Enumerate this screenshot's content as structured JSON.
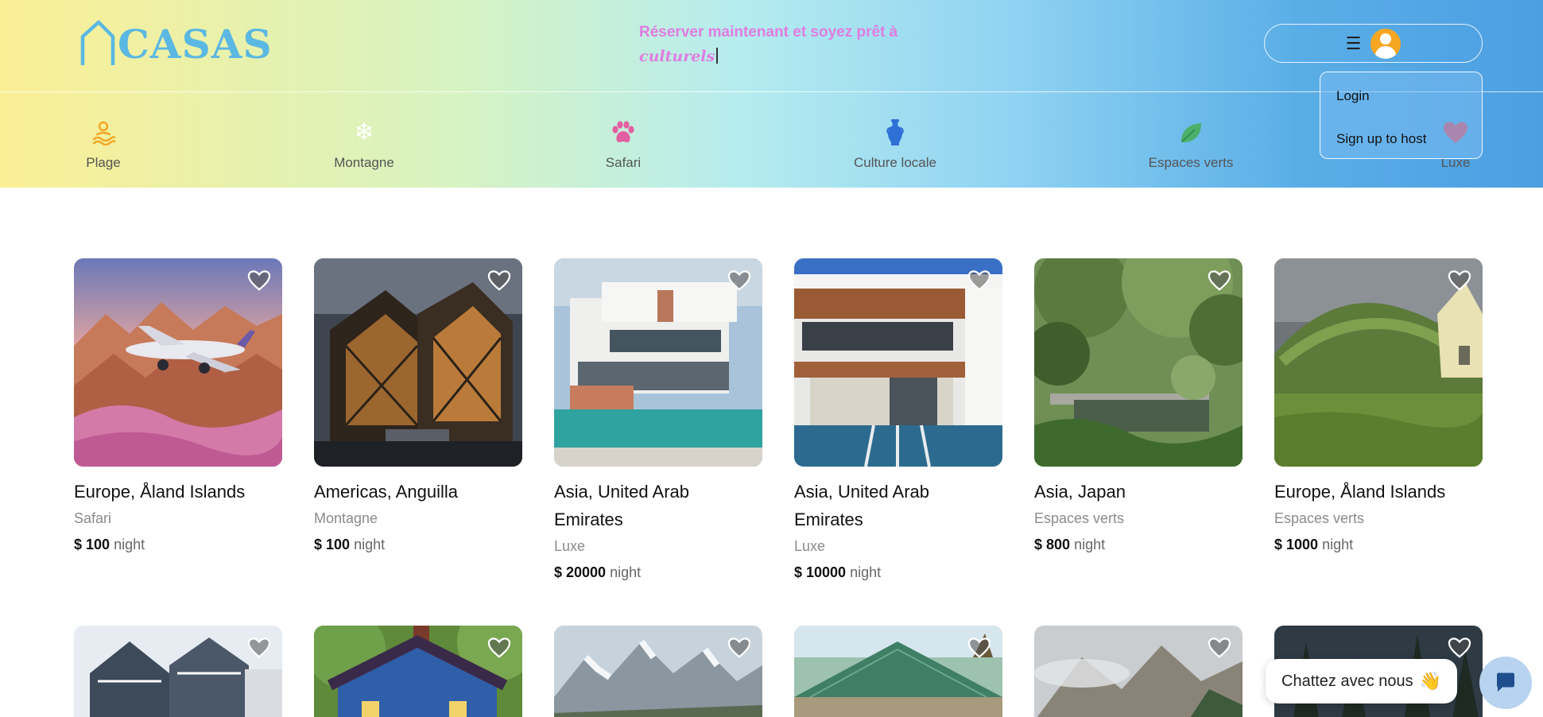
{
  "brand": {
    "name": "CASAS"
  },
  "tagline": {
    "text": "Réserver maintenant et soyez prêt à",
    "emphasis": "culturels"
  },
  "user_menu": {
    "menu_icon": "hamburger-icon",
    "avatar_icon": "user-avatar-icon"
  },
  "dropdown": {
    "login": "Login",
    "signup": "Sign up to host"
  },
  "categories": [
    {
      "label": "Plage",
      "icon": "beach-icon",
      "color": "#f5a623"
    },
    {
      "label": "Montagne",
      "icon": "snowflake-icon",
      "color": "#ffffff"
    },
    {
      "label": "Safari",
      "icon": "paw-icon",
      "color": "#e35fa1"
    },
    {
      "label": "Culture locale",
      "icon": "amphora-icon",
      "color": "#2f6fd6"
    },
    {
      "label": "Espaces verts",
      "icon": "leaf-icon",
      "color": "#4caf6b"
    },
    {
      "label": "Luxe",
      "icon": "heart-icon",
      "color": "#e5485c"
    }
  ],
  "listings": [
    {
      "title": "Europe, Åland Islands",
      "category": "Safari",
      "price": "$ 100",
      "unit": "night"
    },
    {
      "title": "Americas, Anguilla",
      "category": "Montagne",
      "price": "$ 100",
      "unit": "night"
    },
    {
      "title": "Asia, United Arab Emirates",
      "category": "Luxe",
      "price": "$ 20000",
      "unit": "night"
    },
    {
      "title": "Asia, United Arab Emirates",
      "category": "Luxe",
      "price": "$ 10000",
      "unit": "night"
    },
    {
      "title": "Asia, Japan",
      "category": "Espaces verts",
      "price": "$ 800",
      "unit": "night"
    },
    {
      "title": "Europe, Åland Islands",
      "category": "Espaces verts",
      "price": "$ 1000",
      "unit": "night"
    }
  ],
  "chat": {
    "label": "Chattez avec nous",
    "emoji": "👋"
  }
}
